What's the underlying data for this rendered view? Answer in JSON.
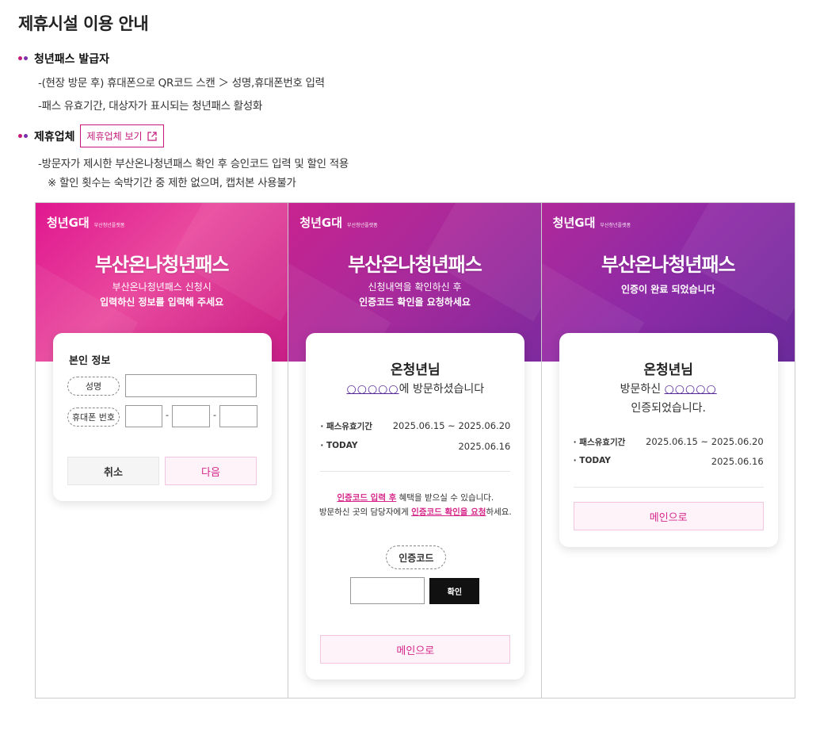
{
  "page": {
    "title": "제휴시설 이용 안내"
  },
  "section1": {
    "heading": "청년패스 발급자",
    "line1": "-(현장 방문 후) 휴대폰으로 QR코드 스캔 ＞ 성명,휴대폰번호 입력",
    "line2": "-패스 유효기간, 대상자가 표시되는 청년패스 활성화"
  },
  "section2": {
    "heading": "제휴업체",
    "button_label": "제휴업체 보기",
    "line1": "-방문자가 제시한 부산온나청년패스 확인 후 승인코드 입력 및 할인 적용",
    "line2": "※ 할인 횟수는 숙박기간 중 제한 없으며, 캡처본 사용불가"
  },
  "brand": {
    "name": "청년G대",
    "sub": "부산청년플랫폼",
    "logo": "부산온나청년패스"
  },
  "panel1": {
    "line1": "부산온나청년패스 신청시",
    "line2": "입력하신 정보를 입력해 주세요",
    "card_title": "본인 정보",
    "name_label": "성명",
    "phone_label": "휴대폰 번호",
    "dash": "-",
    "cancel": "취소",
    "next": "다음"
  },
  "panel2": {
    "line1": "신청내역을 확인하신 후",
    "line2": "인증코드 확인을 요청하세요",
    "name": "온청년님",
    "circles": "○○○○○",
    "visit_suffix": "에 방문하셨습니다",
    "period_label": "· 패스유효기간",
    "period_value": "2025.06.15 ~ 2025.06.20",
    "today_label": "· TODAY",
    "today_value": "2025.06.16",
    "notice1_hl": "인증코드 입력 후",
    "notice1_rest": " 혜택을 받으실 수 있습니다.",
    "notice2_pre": "방문하신 곳의 담당자에게 ",
    "notice2_hl": "인증코드 확인을 요청",
    "notice2_post": "하세요.",
    "code_label": "인증코드",
    "confirm": "확인",
    "main": "메인으로"
  },
  "panel3": {
    "line1": "인증이 완료 되었습니다",
    "name": "온청년님",
    "visit_prefix": "방문하신 ",
    "circles": "○○○○○",
    "done": "인증되었습니다.",
    "period_label": "· 패스유효기간",
    "period_value": "2025.06.15 ~ 2025.06.20",
    "today_label": "· TODAY",
    "today_value": "2025.06.16",
    "main": "메인으로"
  },
  "colors": {
    "accent": "#c41a7a",
    "purple": "#5a2a9a"
  }
}
